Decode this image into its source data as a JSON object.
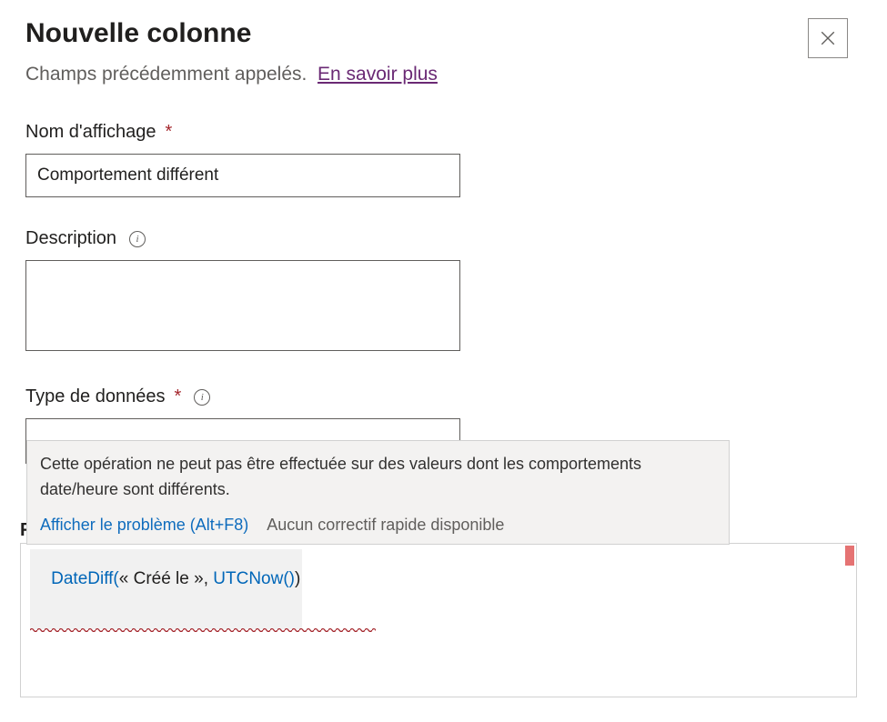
{
  "header": {
    "title": "Nouvelle colonne",
    "subtitle": "Champs précédemment appelés.",
    "learn_more": "En savoir plus"
  },
  "fields": {
    "display_name": {
      "label": "Nom d'affichage",
      "value": "Comportement différent",
      "required": true
    },
    "description": {
      "label": "Description",
      "value": ""
    },
    "data_type": {
      "label": "Type de données",
      "required": true
    },
    "partial_label": "F"
  },
  "tooltip": {
    "message": "Cette opération ne peut pas être effectuée sur des valeurs dont les comportements date/heure sont différents.",
    "show_problem": "Afficher le problème (Alt+F8)",
    "no_fix": "Aucun correctif rapide disponible"
  },
  "formula": {
    "fn_name": "DateDiff(",
    "arg1": "« Créé le »",
    "sep": ", ",
    "fn2": "UTCNow()",
    "close": ")"
  }
}
